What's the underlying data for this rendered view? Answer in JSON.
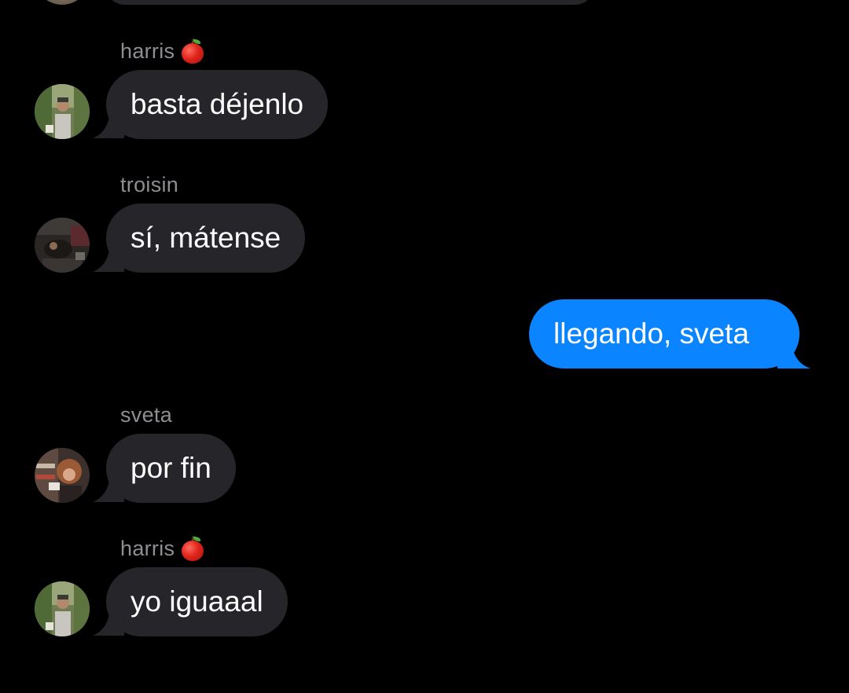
{
  "conversation": {
    "messages": [
      {
        "sender": "harris",
        "sender_emoji": "apple-emoji",
        "text": "basta déjenlo",
        "direction": "incoming",
        "avatar": "avatar-harris"
      },
      {
        "sender": "troisin",
        "text": "sí, mátense",
        "direction": "incoming",
        "avatar": "avatar-troisin"
      },
      {
        "text": "llegando, sveta",
        "direction": "outgoing"
      },
      {
        "sender": "sveta",
        "text": "por fin",
        "direction": "incoming",
        "avatar": "avatar-sveta"
      },
      {
        "sender": "harris",
        "sender_emoji": "apple-emoji",
        "text": "yo iguaaal",
        "direction": "incoming",
        "avatar": "avatar-harris"
      }
    ]
  },
  "colors": {
    "background": "#000000",
    "incoming_bubble": "#262529",
    "outgoing_bubble": "#0a84ff",
    "sender_name": "#8e8e93",
    "message_text": "#ffffff"
  }
}
